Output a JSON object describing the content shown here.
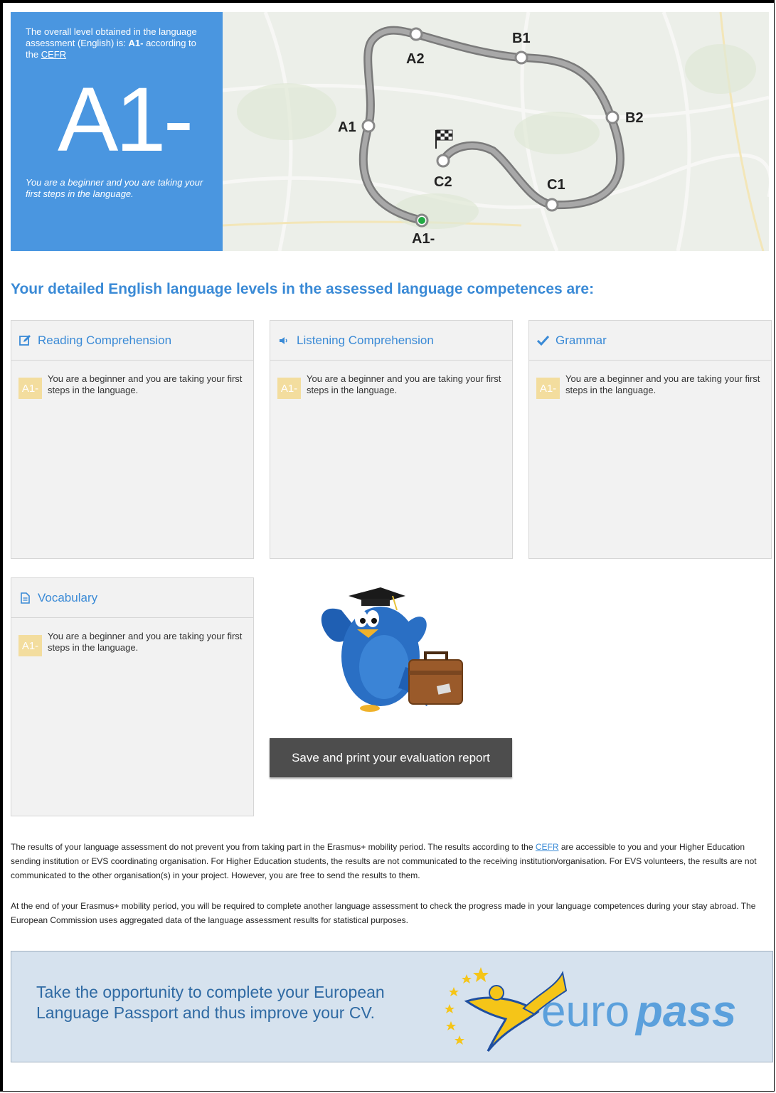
{
  "summary": {
    "intro_prefix": "The overall level obtained in the language assessment (English) is: ",
    "intro_level": "A1-",
    "intro_suffix": " according to the ",
    "cefr_link": "CEFR",
    "big_level": "A1-",
    "description": "You are a beginner and you are taking your first steps in the language."
  },
  "route": {
    "labels": [
      "A1-",
      "A1",
      "A2",
      "B1",
      "B2",
      "C1",
      "C2"
    ],
    "current": "A1-"
  },
  "section_heading": "Your detailed English language levels in the assessed language competences are:",
  "competences": [
    {
      "icon": "edit-icon",
      "title": "Reading Comprehension",
      "level": "A1-",
      "text": "You are a beginner and you are taking your first steps in the language."
    },
    {
      "icon": "speaker-icon",
      "title": "Listening Comprehension",
      "level": "A1-",
      "text": "You are a beginner and you are taking your first steps in the language."
    },
    {
      "icon": "check-icon",
      "title": "Grammar",
      "level": "A1-",
      "text": "You are a beginner and you are taking your first steps in the language."
    },
    {
      "icon": "document-icon",
      "title": "Vocabulary",
      "level": "A1-",
      "text": "You are a beginner and you are taking your first steps in the language."
    }
  ],
  "save_button": "Save and print your evaluation report",
  "paragraph1": {
    "before_link": "The results of your language assessment do not prevent you from taking part in the Erasmus+ mobility period. The results according to the ",
    "link": "CEFR",
    "after_link": " are accessible to you and your Higher Education sending institution or EVS coordinating organisation. For Higher Education students, the results are not communicated to the receiving institution/organisation. For EVS volunteers, the results are not communicated to the other organisation(s) in your project. However, you are free to send the results to them."
  },
  "paragraph2": "At the end of your Erasmus+ mobility period, you will be required to complete another language assessment to check the progress made in your language competences during your stay abroad. The European Commission uses aggregated data of the language assessment results for statistical purposes.",
  "europass": {
    "text": "Take the opportunity to complete your European Language Passport and thus improve your CV.",
    "logo_part1": "euro",
    "logo_part2": "pass"
  },
  "colors": {
    "accent_blue": "#4a96e0",
    "heading_blue": "#3a8ad6",
    "badge": "#f3dd9e",
    "button": "#4d4d4d",
    "current_dot": "#22aa44"
  }
}
